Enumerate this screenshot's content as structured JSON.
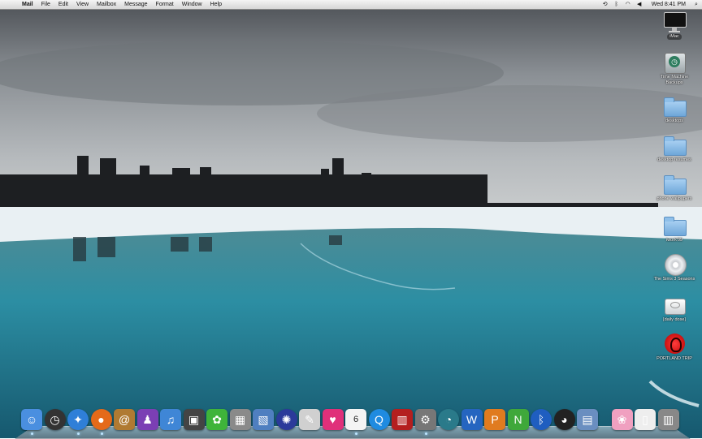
{
  "menubar": {
    "apple": "",
    "app_name": "Mail",
    "menus": [
      "File",
      "Edit",
      "View",
      "Mailbox",
      "Message",
      "Format",
      "Window",
      "Help"
    ],
    "status_icons": [
      "sync-icon",
      "bluetooth-icon",
      "wifi-icon",
      "volume-icon"
    ],
    "clock": "Wed 8:41 PM",
    "spotlight": "spotlight-icon"
  },
  "desktop_icons": [
    {
      "label": "iMac",
      "icon": "imac-icon"
    },
    {
      "label": "Time Machine Backups",
      "icon": "time-machine-drive-icon"
    },
    {
      "label": "desktops",
      "icon": "folder-icon"
    },
    {
      "label": "desktop resumes",
      "icon": "folder-icon"
    },
    {
      "label": "phone wallpapers",
      "icon": "folder-icon"
    },
    {
      "label": "iwork'09",
      "icon": "folder-icon"
    },
    {
      "label": "The Sims 3 Seasons",
      "icon": "dvd-icon"
    },
    {
      "label": "[daily dose]",
      "icon": "disk-image-icon"
    },
    {
      "label": "PORTLAND TRIP",
      "icon": "photo-album-icon"
    }
  ],
  "dock": {
    "items": [
      {
        "name": "finder",
        "glyph": "☺",
        "color": "#4a8fe0"
      },
      {
        "name": "dashboard",
        "glyph": "◷",
        "color": "#333"
      },
      {
        "name": "safari",
        "glyph": "✦",
        "color": "#2f7fd8"
      },
      {
        "name": "firefox",
        "glyph": "●",
        "color": "#e46a1a"
      },
      {
        "name": "address-book",
        "glyph": "@",
        "color": "#b07a32"
      },
      {
        "name": "ichat",
        "glyph": "♟",
        "color": "#7b3fb4"
      },
      {
        "name": "itunes",
        "glyph": "♫",
        "color": "#3f86d6"
      },
      {
        "name": "iphoto",
        "glyph": "▣",
        "color": "#444"
      },
      {
        "name": "ilife",
        "glyph": "✿",
        "color": "#3fb43a"
      },
      {
        "name": "calculator",
        "glyph": "▦",
        "color": "#8a8a8a"
      },
      {
        "name": "preview",
        "glyph": "▧",
        "color": "#4f7fc0"
      },
      {
        "name": "app-store",
        "glyph": "✺",
        "color": "#2b3a9a"
      },
      {
        "name": "pencil",
        "glyph": "✎",
        "color": "#d0d0d0"
      },
      {
        "name": "heart-app",
        "glyph": "♥",
        "color": "#e0307a"
      },
      {
        "name": "ical",
        "glyph": "6",
        "color": "#f4f4f4"
      },
      {
        "name": "quicktime",
        "glyph": "Q",
        "color": "#1f8be0"
      },
      {
        "name": "photo-booth",
        "glyph": "▥",
        "color": "#b41f1f"
      },
      {
        "name": "system-preferences",
        "glyph": "⚙",
        "color": "#777"
      },
      {
        "name": "time-machine",
        "glyph": "◔",
        "color": "#2a7a8a"
      },
      {
        "name": "word",
        "glyph": "W",
        "color": "#2565c0"
      },
      {
        "name": "pages",
        "glyph": "P",
        "color": "#e07b1f"
      },
      {
        "name": "numbers",
        "glyph": "N",
        "color": "#3fa83a"
      },
      {
        "name": "bluetooth",
        "glyph": "ᛒ",
        "color": "#1f5ec0"
      },
      {
        "name": "adium",
        "glyph": "◕",
        "color": "#222"
      },
      {
        "name": "photo-tool",
        "glyph": "▤",
        "color": "#6a8ec0"
      },
      {
        "name": "downloads-stack",
        "glyph": "❀",
        "color": "#f0a0c0"
      },
      {
        "name": "documents-stack",
        "glyph": "▯",
        "color": "#eeeeee"
      },
      {
        "name": "trash",
        "glyph": "▥",
        "color": "#888"
      }
    ]
  },
  "wallpaper_colors": {
    "sky": "#8f959b",
    "ice": "#e6eef2",
    "water": "#2f8ea0"
  }
}
